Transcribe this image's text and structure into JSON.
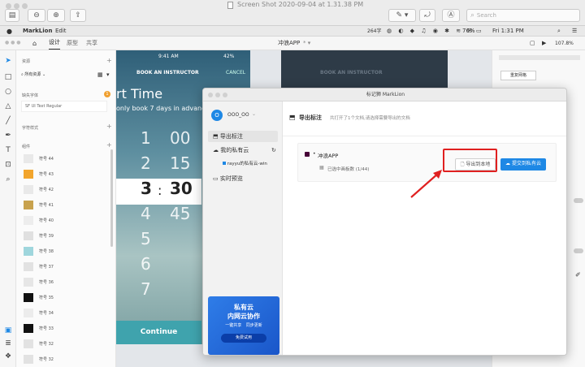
{
  "preview_window": {
    "title": "Screen Shot 2020-09-04 at 1.31.38 PM",
    "search_placeholder": "Search"
  },
  "menubar": {
    "app_name": "MarkLion",
    "menu_edit": "Edit",
    "battery": "76%",
    "clock": "Fri 1:31 PM",
    "net_speed": "264字"
  },
  "toolbar": {
    "tab_design": "设计",
    "tab_prototype": "原型",
    "tab_share": "共享",
    "document_title": "冲浪APP",
    "zoom": "107.8%"
  },
  "left_panel": {
    "assets_heading": "资源",
    "assets_filter": "所有资源",
    "missing_fonts_heading": "缺失字体",
    "missing_font_name": "SF UI Text Regular",
    "missing_badge": "1",
    "text_styles_heading": "字符样式",
    "components_heading": "组件",
    "symbols": [
      {
        "label": "符号 44"
      },
      {
        "label": "符号 43"
      },
      {
        "label": "符号 42"
      },
      {
        "label": "符号 41"
      },
      {
        "label": "符号 40"
      },
      {
        "label": "符号 39"
      },
      {
        "label": "符号 38"
      },
      {
        "label": "符号 37"
      },
      {
        "label": "符号 36"
      },
      {
        "label": "符号 35"
      },
      {
        "label": "符号 34"
      },
      {
        "label": "符号 33"
      },
      {
        "label": "符号 32"
      },
      {
        "label": "符号 32"
      }
    ]
  },
  "canvas": {
    "status_time": "9:41 AM",
    "status_battery": "42%",
    "instructor_header": "BOOK AN INSTRUCTOR",
    "cancel": "CANCEL",
    "start_time": "rt Time",
    "subtitle": "only book 7 days in advance",
    "picker_rows": [
      {
        "h": "1",
        "m": "00"
      },
      {
        "h": "2",
        "m": "15"
      },
      {
        "h": "3",
        "m": "30"
      },
      {
        "h": "4",
        "m": "45"
      },
      {
        "h": "5",
        "m": ""
      },
      {
        "h": "6",
        "m": ""
      },
      {
        "h": "7",
        "m": ""
      }
    ],
    "continue_button": "Continue",
    "right_header": "BOOK AN INSTRUCTOR"
  },
  "right_panel": {
    "reset_grid": "重复网格"
  },
  "dialog": {
    "title": "标记狮 MarkLion",
    "user_name": "OOO_OO",
    "nav_export": "导出标注",
    "nav_cloud": "我的私有云",
    "cloud_item": "rayyu的私有云-win",
    "nav_preview": "实时预览",
    "promo_title_1": "私有云",
    "promo_title_2": "内网云协作",
    "promo_sub_1": "一键共享",
    "promo_sub_2": "同步更新",
    "promo_button": "免费试用",
    "main_heading": "导出标注",
    "main_desc": "共打开了1个文档,请选择需要导出的文档",
    "project_name": "冲浪APP",
    "artboards_selected": "已选中画板数 (1/44)",
    "export_local_button": "导出到本地",
    "submit_cloud_button": "提交到私有云"
  },
  "annotation": {
    "highlight_color": "#e02020"
  }
}
